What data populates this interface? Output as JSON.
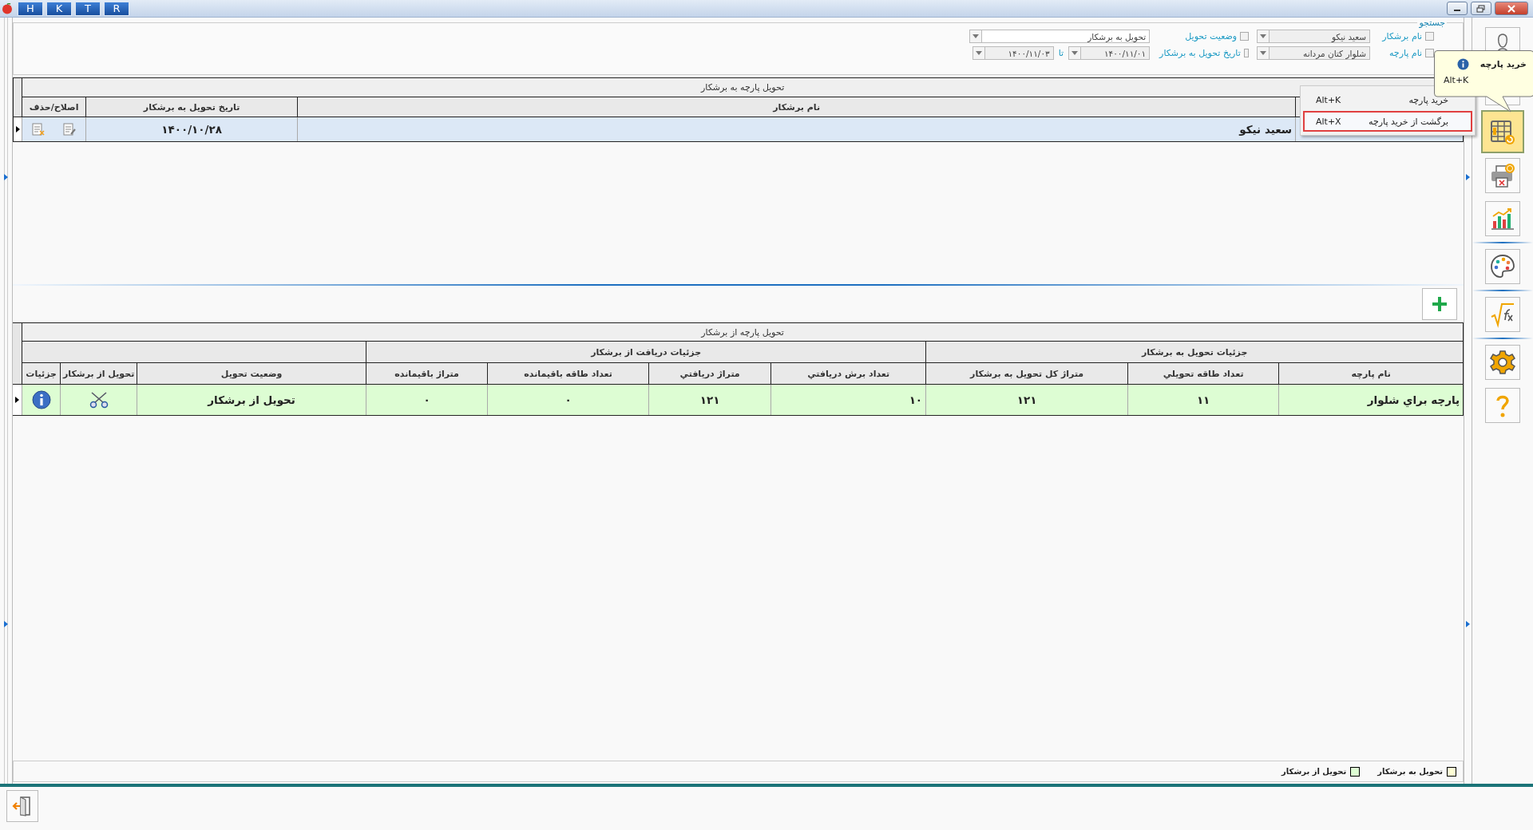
{
  "title_bar": {
    "tabs": [
      "R",
      "T",
      "K",
      "H"
    ]
  },
  "search": {
    "legend": "جستجو",
    "filters": [
      {
        "kind": "combo",
        "label": "نام برشکار",
        "checked": false,
        "value": "سعید نیکو"
      },
      {
        "kind": "combo",
        "label": "نام پارچه",
        "checked": false,
        "value": "شلوار کتان مردانه"
      },
      {
        "kind": "combo",
        "label": "وضعیت تحویل",
        "checked": false,
        "value": "تحویل به برشکار"
      },
      {
        "kind": "date_range",
        "label": "تاریخ تحویل به برشکار",
        "checked": false,
        "from": "۱۴۰۰/۱۱/۰۱",
        "to_label": "تا",
        "to": "۱۴۰۰/۱۱/۰۳"
      }
    ]
  },
  "deliveries_table": {
    "title": "تحویل پارچه به برشکار",
    "columns": [
      "نام برشکار",
      "تاریخ تحویل به برشکار",
      "اصلاح/حذف"
    ],
    "rows": [
      {
        "name": "سعید نیکو",
        "date": "۱۴۰۰/۱۰/۲۸",
        "selected": true
      }
    ]
  },
  "returns_table": {
    "title": "تحویل پارچه از برشکار",
    "groups": [
      {
        "label": "جزئیات تحویل به برشکار",
        "columns": [
          "نام پارچه",
          "تعداد طاقه تحویلي",
          "متراژ کل تحویل به برشکار"
        ]
      },
      {
        "label": "جزئیات دریافت از برشکار",
        "columns": [
          "تعداد برش دریافتي",
          "متراژ دریافتي",
          "تعداد طاقه باقیمانده",
          "متراژ باقیمانده"
        ]
      },
      {
        "columns": [
          "وضعیت تحویل",
          "تحویل از برشکار",
          "جزئیات"
        ]
      }
    ],
    "rows": [
      {
        "cells": [
          "پارچه براي شلوار",
          "۱۱",
          "۱۲۱",
          "۱۰",
          "۱۲۱",
          "۰",
          "۰",
          "تحویل از برشکار"
        ],
        "selected": true,
        "color": "#ddfdd3"
      }
    ]
  },
  "legend": [
    {
      "label": "تحویل به برشکار",
      "color": "#ffffd5"
    },
    {
      "label": "تحویل از برشکار",
      "color": "#ddfdd3"
    }
  ],
  "context_menu": {
    "items": [
      {
        "label": "خرید پارچه",
        "shortcut": "Alt+K",
        "selected": false
      },
      {
        "label": "برگشت از خرید پارچه",
        "shortcut": "Alt+X",
        "selected": true
      }
    ]
  },
  "tooltip": {
    "title": "خرید پارچه",
    "shortcut": "Alt+K"
  },
  "sidebar": {
    "groups": [
      [
        {
          "kind": "user",
          "selected": false
        },
        {
          "kind": "blank",
          "selected": false
        },
        {
          "kind": "table_money",
          "selected": true
        },
        {
          "kind": "printer",
          "selected": false
        },
        {
          "kind": "chart",
          "selected": false
        }
      ],
      [
        {
          "kind": "palette",
          "selected": false
        }
      ],
      [
        {
          "kind": "formula",
          "selected": false
        }
      ],
      [
        {
          "kind": "gear",
          "selected": false
        },
        {
          "kind": "help",
          "selected": false
        }
      ]
    ]
  }
}
